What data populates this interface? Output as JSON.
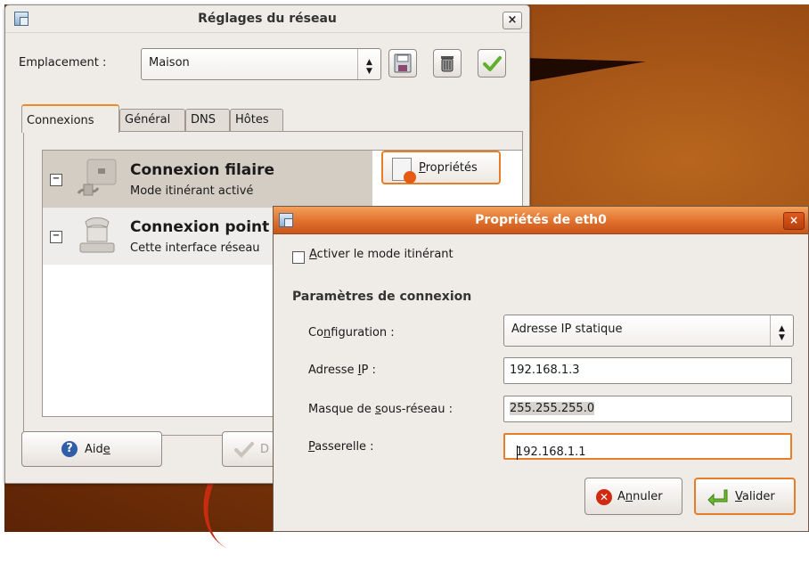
{
  "main_window": {
    "title": "Réglages du réseau",
    "close_glyph": "×",
    "location_label": "Emplacement :",
    "location_value": "Maison",
    "tabs": [
      "Connexions",
      "Général",
      "DNS",
      "Hôtes"
    ],
    "connections": [
      {
        "name": "Connexion filaire",
        "description": "Mode itinérant activé",
        "checkbox": "−",
        "icon": "wired-network-icon"
      },
      {
        "name": "Connexion point à point",
        "description": "Cette interface réseau",
        "checkbox": "−",
        "icon": "modem-phone-icon"
      }
    ],
    "properties_button": {
      "mnemonic": "P",
      "rest": "ropriétés"
    },
    "help_button": {
      "pre": "Aid",
      "mnemonic": "e",
      "post": ""
    },
    "hidden_button_label": "D"
  },
  "dialog": {
    "title": "Propriétés de eth0",
    "close_glyph": "×",
    "roaming_checkbox": {
      "mnemonic": "A",
      "rest": "ctiver le mode itinérant",
      "checked": false
    },
    "section_title": "Paramètres de connexion",
    "configuration": {
      "label_pre": "Co",
      "label_mnemonic": "n",
      "label_post": "figuration :",
      "value": "Adresse IP statique"
    },
    "ip": {
      "label_pre": "Adresse ",
      "label_mnemonic": "I",
      "label_post": "P :",
      "value": "192.168.1.3"
    },
    "netmask": {
      "label_pre": "Masque de ",
      "label_mnemonic": "s",
      "label_post": "ous-réseau :",
      "value": "255.255.255.0"
    },
    "gateway": {
      "label_pre": "",
      "label_mnemonic": "P",
      "label_post": "asserelle :",
      "value": "192.168.1.1"
    },
    "cancel_button": {
      "pre": "A",
      "mnemonic": "n",
      "post": "nuler"
    },
    "ok_button": {
      "pre": "",
      "mnemonic": "V",
      "post": "alider"
    }
  },
  "colors": {
    "accent": "#e87d28",
    "desktop": "#8c3f0d",
    "window_bg": "#efebe7"
  }
}
